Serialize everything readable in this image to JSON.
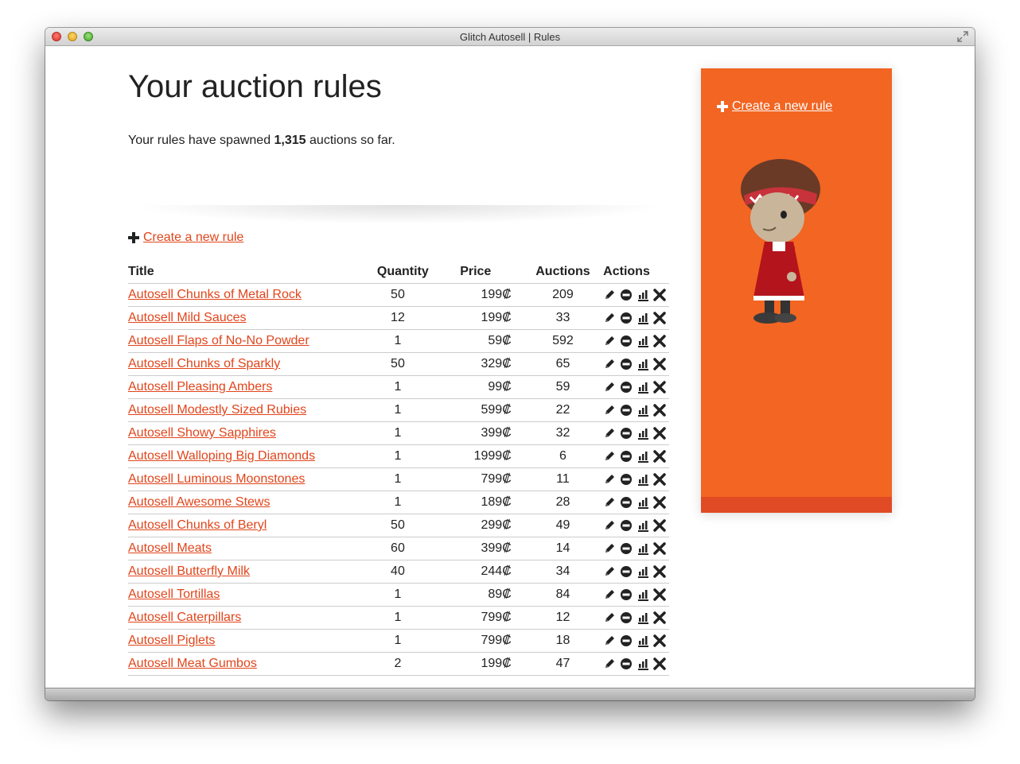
{
  "window": {
    "title": "Glitch Autosell | Rules"
  },
  "page": {
    "heading": "Your auction rules",
    "summary_prefix": "Your rules have spawned ",
    "summary_count": "1,315",
    "summary_suffix": " auctions so far.",
    "create_link": "Create a new rule"
  },
  "table": {
    "headers": {
      "title": "Title",
      "quantity": "Quantity",
      "price": "Price",
      "auctions": "Auctions",
      "actions": "Actions"
    },
    "rows": [
      {
        "title": "Autosell Chunks of Metal Rock",
        "quantity": "50",
        "price": "199₡",
        "auctions": "209"
      },
      {
        "title": "Autosell Mild Sauces",
        "quantity": "12",
        "price": "199₡",
        "auctions": "33"
      },
      {
        "title": "Autosell Flaps of No-No Powder",
        "quantity": "1",
        "price": "59₡",
        "auctions": "592"
      },
      {
        "title": "Autosell Chunks of Sparkly",
        "quantity": "50",
        "price": "329₡",
        "auctions": "65"
      },
      {
        "title": "Autosell Pleasing Ambers",
        "quantity": "1",
        "price": "99₡",
        "auctions": "59"
      },
      {
        "title": "Autosell Modestly Sized Rubies",
        "quantity": "1",
        "price": "599₡",
        "auctions": "22"
      },
      {
        "title": "Autosell Showy Sapphires",
        "quantity": "1",
        "price": "399₡",
        "auctions": "32"
      },
      {
        "title": "Autosell Walloping Big Diamonds",
        "quantity": "1",
        "price": "1999₡",
        "auctions": "6"
      },
      {
        "title": "Autosell Luminous Moonstones",
        "quantity": "1",
        "price": "799₡",
        "auctions": "11"
      },
      {
        "title": "Autosell Awesome Stews",
        "quantity": "1",
        "price": "189₡",
        "auctions": "28"
      },
      {
        "title": "Autosell Chunks of Beryl",
        "quantity": "50",
        "price": "299₡",
        "auctions": "49"
      },
      {
        "title": "Autosell Meats",
        "quantity": "60",
        "price": "399₡",
        "auctions": "14"
      },
      {
        "title": "Autosell Butterfly Milk",
        "quantity": "40",
        "price": "244₡",
        "auctions": "34"
      },
      {
        "title": "Autosell Tortillas",
        "quantity": "1",
        "price": "89₡",
        "auctions": "84"
      },
      {
        "title": "Autosell Caterpillars",
        "quantity": "1",
        "price": "799₡",
        "auctions": "12"
      },
      {
        "title": "Autosell Piglets",
        "quantity": "1",
        "price": "799₡",
        "auctions": "18"
      },
      {
        "title": "Autosell Meat Gumbos",
        "quantity": "2",
        "price": "199₡",
        "auctions": "47"
      }
    ],
    "action_icons": [
      "pencil-icon",
      "disable-icon",
      "stats-icon",
      "delete-icon"
    ]
  },
  "sidebar": {
    "create_link": "Create a new rule",
    "avatar": "glitch-avatar"
  },
  "colors": {
    "link": "#e1451b",
    "sidebar_bg": "#f26522",
    "sidebar_footer": "#e04b26"
  }
}
